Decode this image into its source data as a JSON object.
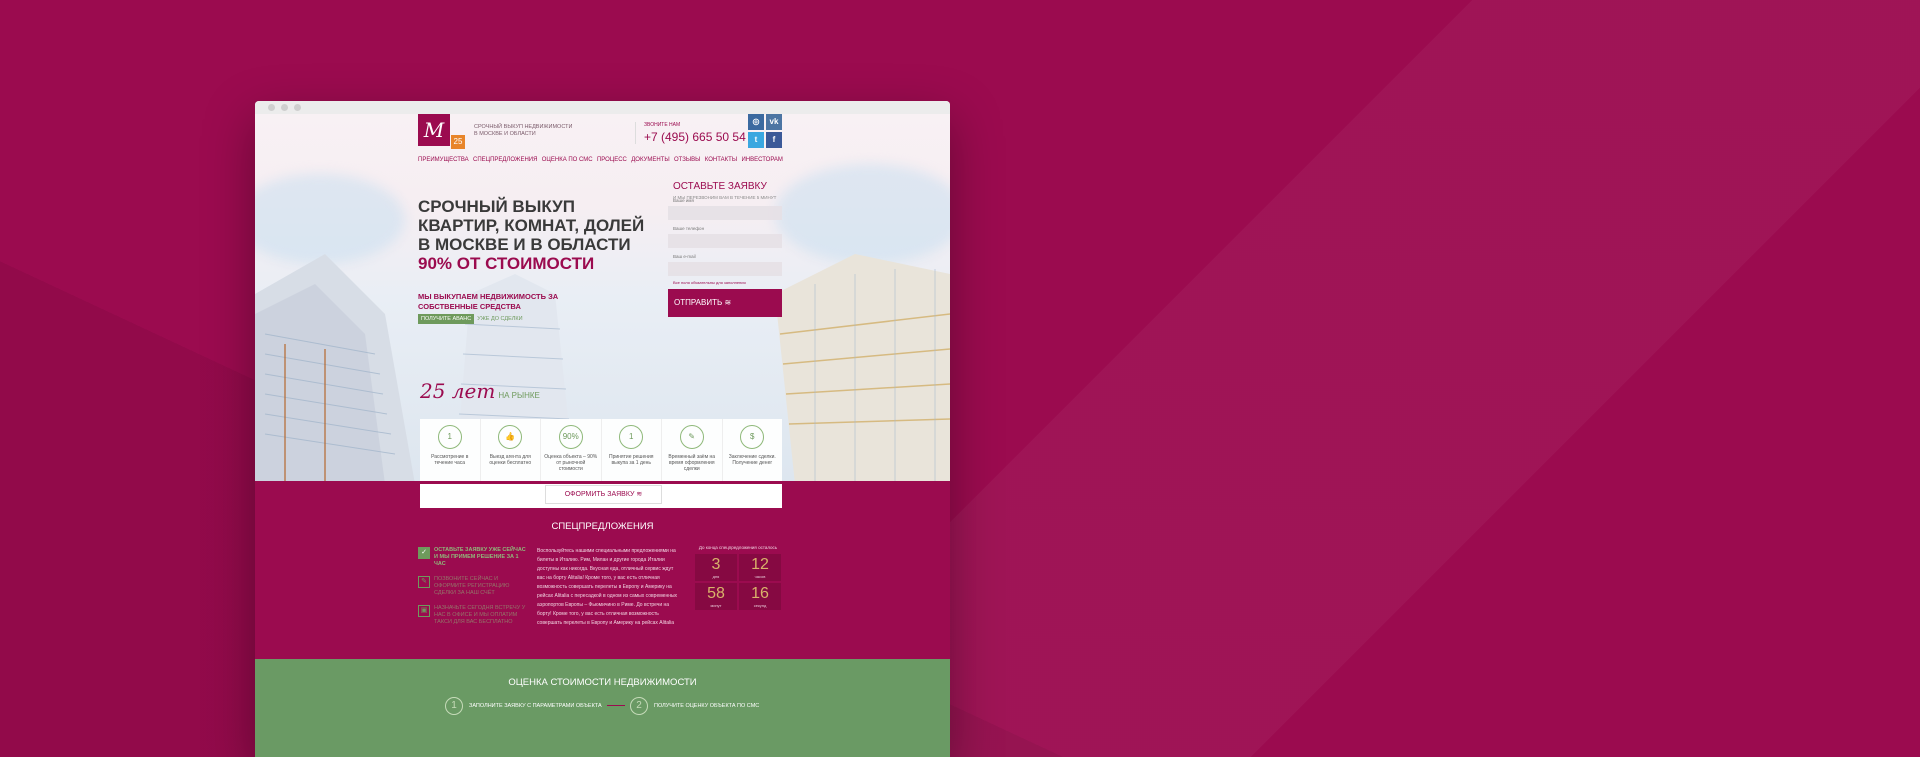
{
  "header": {
    "tagline": "Срочный выкуп недвижимости в Москве и области",
    "logo_letter": "М",
    "logo_badge": "25",
    "call_label": "Звоните нам",
    "phone": "+7 (495) 665 50 54"
  },
  "socials": [
    {
      "icon": "instagram-icon",
      "label": "◎",
      "color": "#3b6aa0"
    },
    {
      "icon": "vk-icon",
      "label": "vk",
      "color": "#4c75a3"
    },
    {
      "icon": "twitter-icon",
      "label": "t",
      "color": "#3aa7e0"
    },
    {
      "icon": "facebook-icon",
      "label": "f",
      "color": "#3b5998"
    }
  ],
  "nav": [
    "Преимущества",
    "Спецпредложения",
    "Оценка по СМС",
    "Процесс",
    "Документы",
    "Отзывы",
    "Контакты",
    "Инвесторам"
  ],
  "hero": {
    "headline_lines": [
      "Срочный выкуп",
      "квартир, комнат, долей",
      "в Москве и в области"
    ],
    "headline_accent": "90% от стоимости",
    "subhead": "Мы выкупаем недвижимость за собственные средства",
    "advance_badge": "Получите аванс",
    "advance_text": "уже до сделки"
  },
  "form": {
    "title": "Оставьте заявку",
    "subtitle": "И мы перезвоним вам в течение 5 минут",
    "fields": [
      {
        "label": "Ваше имя",
        "placeholder": ""
      },
      {
        "label": "Ваше телефон",
        "placeholder": ""
      },
      {
        "label": "Ваш e-mail",
        "placeholder": ""
      }
    ],
    "required_note": "Все поля обязательны для заполнения",
    "submit": "Отправить"
  },
  "years": {
    "num": "25 лет",
    "text": "на рынке"
  },
  "features": [
    {
      "icon": "1",
      "text": "Рассмотрение в течение часа"
    },
    {
      "icon": "👍",
      "text": "Выезд агента для оценки бесплатно"
    },
    {
      "icon": "90%",
      "text": "Оценка объекта – 90% от рыночной стоимости"
    },
    {
      "icon": "1",
      "text": "Принятие решения выкупа за 1 день"
    },
    {
      "icon": "✎",
      "text": "Временный заём на время оформления сделки"
    },
    {
      "icon": "$",
      "text": "Заключение сделки. Получение денег"
    }
  ],
  "order_button": "Оформить заявку",
  "special": {
    "title": "Спецпредложения",
    "items": [
      {
        "icon": "✓",
        "text": "Оставьте заявку уже сейчас и мы примем решение за 1 час",
        "active": true
      },
      {
        "icon": "✎",
        "text": "Позвоните сейчас и оформите регистрацию сделки за наш счёт",
        "active": false
      },
      {
        "icon": "▣",
        "text": "Назначьте сегодня встречу у нас в офисе и мы оплатим такси для вас бесплатно",
        "active": false
      }
    ],
    "body": "Воспользуйтесь нашими специальными предложениями на билеты в Италию. Рим, Милан и другие города Италии доступны как никогда. Вкусная еда, отличный сервис ждут вас на борту Alitalia! Кроме того, у вас есть отличная возможность совершать перелеты в Европу и Америку на рейсах Alitalia с пересадкой в одном из самых современных аэропортов Европы – Фьюмичино в Риме. До встречи на борту! Кроме того, у вас есть отличная возможность совершать перелеты в Европу и Америку на рейсах Alitalia",
    "timer_caption": "До конца спецпредложения осталось",
    "timer": [
      {
        "value": "3",
        "unit": "дня"
      },
      {
        "value": "12",
        "unit": "часов"
      },
      {
        "value": "58",
        "unit": "минут"
      },
      {
        "value": "16",
        "unit": "секунд"
      }
    ]
  },
  "valuation": {
    "title": "Оценка стоимости недвижимости",
    "steps": [
      {
        "num": "1",
        "text": "Заполните заявку с параметрами объекта"
      },
      {
        "num": "2",
        "text": "Получите оценку объекта по СМС"
      }
    ]
  }
}
